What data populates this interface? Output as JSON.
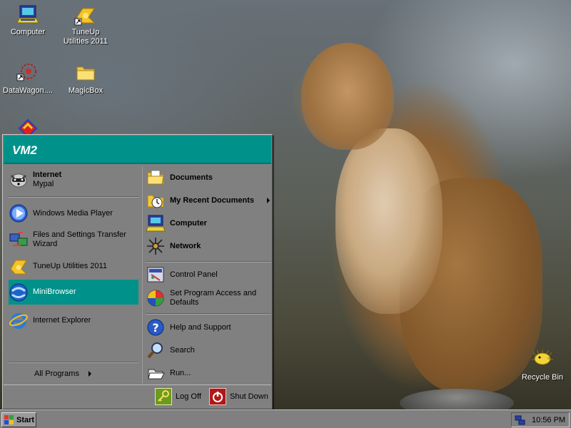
{
  "desktop": {
    "icons": [
      {
        "label": "Computer",
        "icon": "computer-icon"
      },
      {
        "label": "TuneUp Utilities 2011",
        "icon": "tuneup-icon"
      },
      {
        "label": "DataWagon....",
        "icon": "datawagon-icon"
      },
      {
        "label": "MagicBox",
        "icon": "folder-icon"
      },
      {
        "label": "Recycle Bin",
        "icon": "recycle-bin-icon"
      }
    ]
  },
  "start_menu": {
    "user": "VM2",
    "pinned": {
      "internet": {
        "title": "Internet",
        "subtitle": "Mypal"
      }
    },
    "left_items": [
      {
        "label": "Windows Media Player"
      },
      {
        "label": "Files and Settings Transfer Wizard"
      },
      {
        "label": "TuneUp Utilities 2011"
      },
      {
        "label": "MiniBrowser"
      },
      {
        "label": "Internet Explorer"
      }
    ],
    "all_programs": "All Programs",
    "right_items": [
      {
        "label": "Documents"
      },
      {
        "label": "My Recent Documents"
      },
      {
        "label": "Computer"
      },
      {
        "label": "Network"
      },
      {
        "label": "Control Panel"
      },
      {
        "label": "Set Program Access and Defaults"
      },
      {
        "label": "Help and Support"
      },
      {
        "label": "Search"
      },
      {
        "label": "Run..."
      }
    ],
    "log_off": "Log Off",
    "shut_down": "Shut Down"
  },
  "taskbar": {
    "start_label": "Start",
    "clock": "10:56 PM"
  },
  "colors": {
    "header": "#00928a",
    "highlight": "#00928a"
  }
}
